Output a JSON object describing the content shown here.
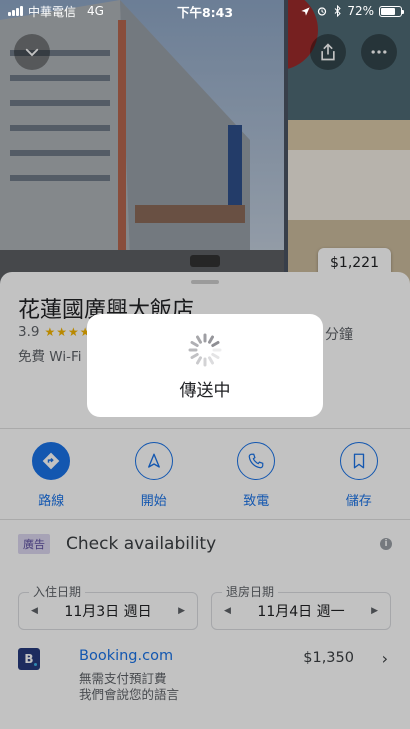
{
  "status_bar": {
    "carrier": "中華電信",
    "network": "4G",
    "time": "下午8:43",
    "battery_text": "72%",
    "battery_level": 0.72,
    "icons": [
      "location-arrow-icon",
      "alarm-icon",
      "bluetooth-icon"
    ]
  },
  "hero": {
    "side_price": "$1,221",
    "back_icon": "chevron-down-icon",
    "share_icon": "share-icon",
    "more_icon": "more-horizontal-icon"
  },
  "hotel": {
    "name": "花蓮國廣興大飯店",
    "rating": "3.9",
    "stars_filled": 4,
    "duration_suffix": "分鐘",
    "amenity": "免費 Wi-Fi"
  },
  "actions": [
    {
      "label": "路線",
      "icon": "directions-icon"
    },
    {
      "label": "開始",
      "icon": "navigation-arrow-icon"
    },
    {
      "label": "致電",
      "icon": "phone-icon"
    },
    {
      "label": "儲存",
      "icon": "bookmark-icon"
    }
  ],
  "booking": {
    "ad_badge": "廣告",
    "title": "Check availability",
    "check_in_label": "入住日期",
    "check_in_value": "11月3日 週日",
    "check_out_label": "退房日期",
    "check_out_value": "11月4日 週一"
  },
  "offer": {
    "logo_letter": "B",
    "provider": "Booking.com",
    "line1": "無需支付預訂費",
    "line2": "我們會說您的語言",
    "price": "$1,350"
  },
  "dialog": {
    "text": "傳送中"
  },
  "colors": {
    "accent": "#1a73e8",
    "star": "#f4b400",
    "ad_badge_bg": "#dcd7ef",
    "booking_brand": "#273b7d"
  }
}
